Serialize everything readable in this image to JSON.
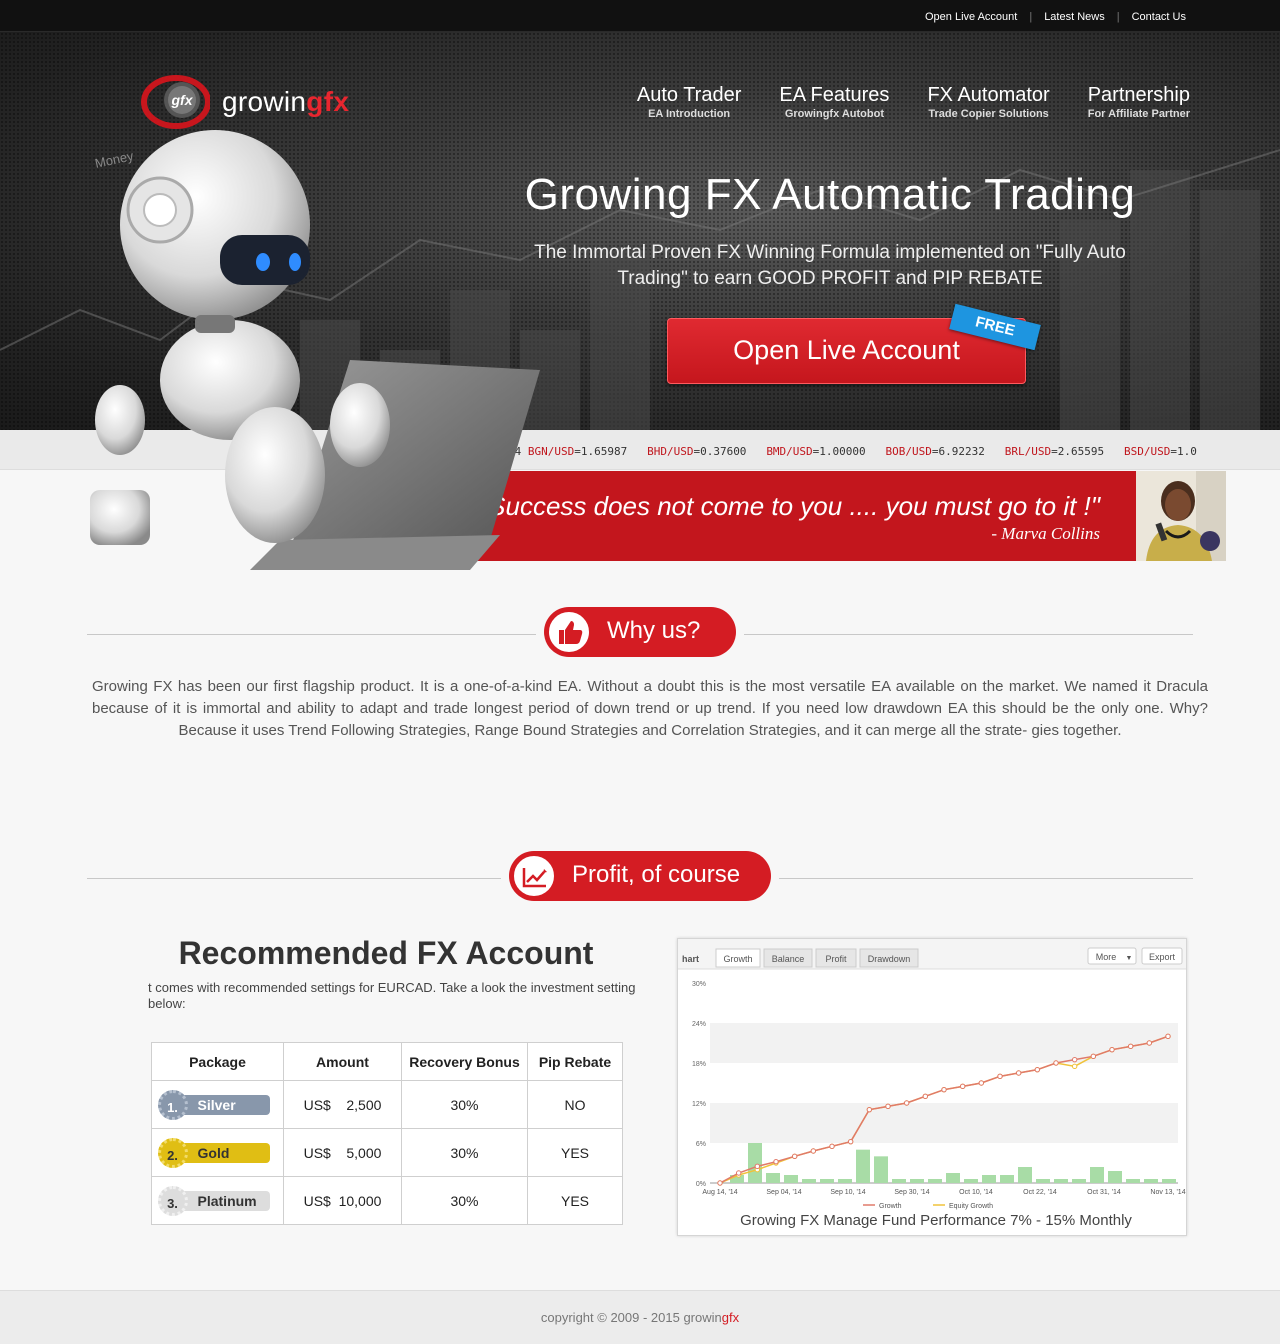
{
  "topbar": {
    "links": [
      "Open Live Account",
      "Latest News",
      "Contact Us"
    ]
  },
  "brand": {
    "logo_mark": "gfx",
    "name_main": "growin",
    "name_accent": "gfx"
  },
  "nav": [
    {
      "title": "Auto Trader",
      "subtitle": "EA Introduction"
    },
    {
      "title": "EA Features",
      "subtitle": "Growingfx Autobot"
    },
    {
      "title": "FX Automator",
      "subtitle": "Trade Copier Solutions"
    },
    {
      "title": "Partnership",
      "subtitle": "For Affiliate Partner"
    }
  ],
  "hero": {
    "title": "Growing FX Automatic Trading",
    "subtitle": "The Immortal Proven FX Winning Formula implemented on \"Fully Auto Trading\" to earn GOOD PROFIT and PIP REBATE",
    "cta_label": "Open Live Account",
    "cta_badge": "FREE",
    "bg_word": "Money"
  },
  "ticker": {
    "lead": "94 ",
    "rates": [
      {
        "pair": "BGN/USD",
        "value": "=1.65987"
      },
      {
        "pair": "BHD/USD",
        "value": "=0.37600"
      },
      {
        "pair": "BMD/USD",
        "value": "=1.00000"
      },
      {
        "pair": "BOB/USD",
        "value": "=6.92232"
      },
      {
        "pair": "BRL/USD",
        "value": "=2.65595"
      },
      {
        "pair": "BSD/USD",
        "value": "=1.0"
      }
    ]
  },
  "quote": {
    "text": "\"Success does not come to you .... you must go to it !\"",
    "author": "- Marva Collins"
  },
  "why": {
    "heading": "Why us?",
    "body": "Growing FX has  been  our first  flagship  product. It is  a  one-of-a-kind EA. Without a doubt  this is the  most versatile EA available on the market. We named  it  Dracula because of  it is immortal and ability to  adapt and trade longest  period  of  down trend  or up trend. If you need low drawdown EA  this  should  be  the  only one.  Why?  Because  it  uses  Trend  Following  Strategies,  Range Bound Strategies  and  Correlation Strategies,  and  it can merge all  the  strate- gies together."
  },
  "profit": {
    "heading": "Profit, of course",
    "rec_title": "Recommended FX Account",
    "rec_desc": "t comes with recommended settings for EURCAD. Take a look the investment setting  below:",
    "table": {
      "headers": [
        "Package",
        "Amount",
        "Recovery Bonus",
        "Pip Rebate"
      ],
      "rows": [
        {
          "num": "1.",
          "name": "Silver",
          "amount": "US$    2,500",
          "bonus": "30%",
          "rebate": "NO"
        },
        {
          "num": "2.",
          "name": "Gold",
          "amount": "US$    5,000",
          "bonus": "30%",
          "rebate": "YES"
        },
        {
          "num": "3.",
          "name": "Platinum",
          "amount": "US$  10,000",
          "bonus": "30%",
          "rebate": "YES"
        }
      ]
    },
    "chart_caption": "Growing FX Manage Fund Performance  7% - 15% Monthly"
  },
  "chart_data": {
    "type": "line",
    "title": "",
    "tabs": [
      "hart",
      "Growth",
      "Balance",
      "Profit",
      "Drawdown"
    ],
    "buttons": [
      "More",
      "Export"
    ],
    "y_ticks": [
      "30%",
      "24%",
      "18%",
      "12%",
      "6%",
      "0%"
    ],
    "ylim": [
      0,
      30
    ],
    "x_ticks": [
      "Aug 14, '14",
      "Sep 04, '14",
      "Sep 10, '14",
      "Sep 30, '14",
      "Oct 10, '14",
      "Oct 22, '14",
      "Oct 31, '14",
      "Nov 13, '14"
    ],
    "series": [
      {
        "name": "Growth",
        "color": "#e07a6a",
        "values": [
          0,
          1.5,
          2.5,
          3.2,
          4,
          4.8,
          5.5,
          6.2,
          11,
          11.5,
          12,
          13,
          14,
          14.5,
          15,
          16,
          16.5,
          17,
          18,
          18.5,
          19,
          20,
          20.5,
          21,
          22
        ]
      },
      {
        "name": "Equity Growth",
        "color": "#f0c23a",
        "values": [
          0,
          1.2,
          2,
          3,
          4,
          4.8,
          5.5,
          6.2,
          11,
          11.5,
          12,
          13,
          14,
          14.5,
          15,
          16,
          16.5,
          17,
          18,
          17.5,
          19,
          20,
          20.5,
          21,
          22
        ]
      }
    ],
    "bars": {
      "color": "#a8dca6",
      "values": [
        0,
        1.2,
        6,
        1.5,
        1.2,
        0.6,
        0.6,
        0.6,
        5,
        4,
        0.6,
        0.6,
        0.6,
        1.5,
        0.6,
        1.2,
        1.2,
        2.4,
        0.6,
        0.6,
        0.6,
        2.4,
        1.8,
        0.6,
        0.6,
        0.6
      ]
    },
    "legend": [
      "Growth",
      "Equity Growth"
    ]
  },
  "footer": {
    "copy_main": "copyright © 2009 - 2015 growin",
    "copy_accent": "gfx"
  },
  "colors": {
    "brand_red": "#d41c23",
    "badge_blue": "#1e95e0"
  }
}
